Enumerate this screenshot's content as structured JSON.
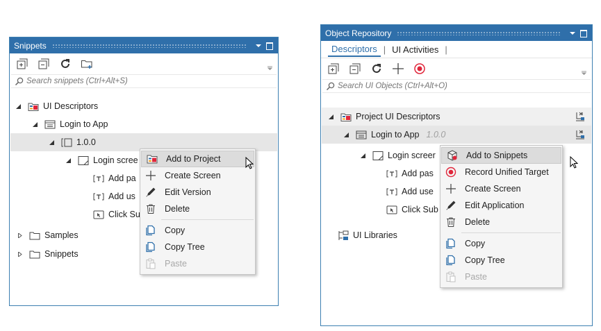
{
  "left": {
    "title": "Snippets",
    "search_placeholder": "Search snippets (Ctrl+Alt+S)",
    "tree": {
      "ui_descriptors": "UI Descriptors",
      "login_to_app": "Login to App",
      "version": "1.0.0",
      "login_screen": "Login scree",
      "add_pass": "Add pa",
      "add_user": "Add us",
      "click_submit": "Click Su",
      "samples": "Samples",
      "snippets": "Snippets"
    },
    "menu": {
      "add_to_project": "Add to Project",
      "create_screen": "Create Screen",
      "edit_version": "Edit Version",
      "delete": "Delete",
      "copy": "Copy",
      "copy_tree": "Copy Tree",
      "paste": "Paste"
    }
  },
  "right": {
    "title": "Object Repository",
    "tabs": [
      "Descriptors",
      "UI Activities"
    ],
    "search_placeholder": "Search UI Objects (Ctrl+Alt+O)",
    "tree": {
      "project_ui_descriptors": "Project UI Descriptors",
      "login_to_app": "Login to App",
      "version": "1.0.0",
      "login_screen": "Login screer",
      "add_pass": "Add pas",
      "add_user": "Add use",
      "click_submit": "Click Sub",
      "ui_libraries": "UI Libraries"
    },
    "menu": {
      "add_to_snippets": "Add to Snippets",
      "record_unified_target": "Record Unified Target",
      "create_screen": "Create Screen",
      "edit_application": "Edit Application",
      "delete": "Delete",
      "copy": "Copy",
      "copy_tree": "Copy Tree",
      "paste": "Paste"
    }
  },
  "colors": {
    "titlebar": "#2f6faa",
    "border": "#3c7fb1",
    "accent_red": "#e0263b",
    "icon_blue": "#2f6faa"
  }
}
